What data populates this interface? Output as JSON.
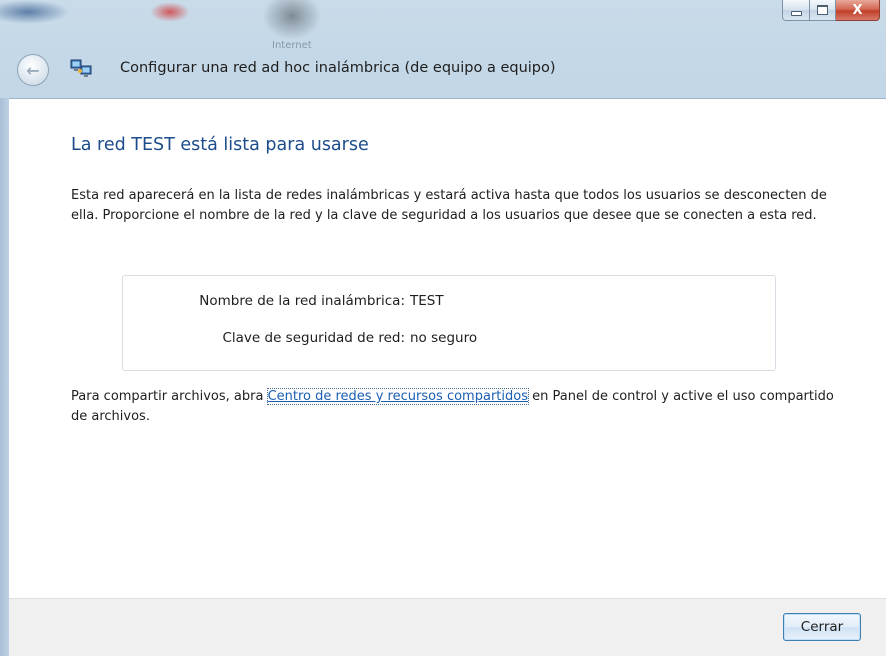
{
  "window": {
    "title": "Configurar una red ad hoc inalámbrica (de equipo a equipo)",
    "background_caption": "Internet",
    "controls": {
      "minimize_icon": "minimize-icon",
      "maximize_icon": "maximize-icon",
      "close_label": "X"
    }
  },
  "nav": {
    "back_icon": "back-arrow-icon",
    "app_icon": "network-computers-icon"
  },
  "main": {
    "heading": "La red TEST está lista para usarse",
    "description": "Esta red aparecerá en la lista de redes inalámbricas y estará activa hasta que todos los usuarios se desconecten de ella. Proporcione el nombre de la red y la clave de seguridad a los usuarios que desee que se conecten a esta red.",
    "info": {
      "network_name_label": "Nombre de la red inalámbrica:",
      "network_name_value": "TEST",
      "security_key_label": "Clave de seguridad de red:",
      "security_key_value": "no seguro"
    },
    "share": {
      "prefix": "Para compartir archivos, abra ",
      "link": "Centro de redes y recursos compartidos",
      "suffix": " en Panel de control y active el uso compartido de archivos."
    }
  },
  "footer": {
    "close_button": "Cerrar"
  },
  "colors": {
    "heading": "#1c4c8c",
    "link": "#1a5fb4",
    "footer_bg": "#f0f0f0"
  }
}
